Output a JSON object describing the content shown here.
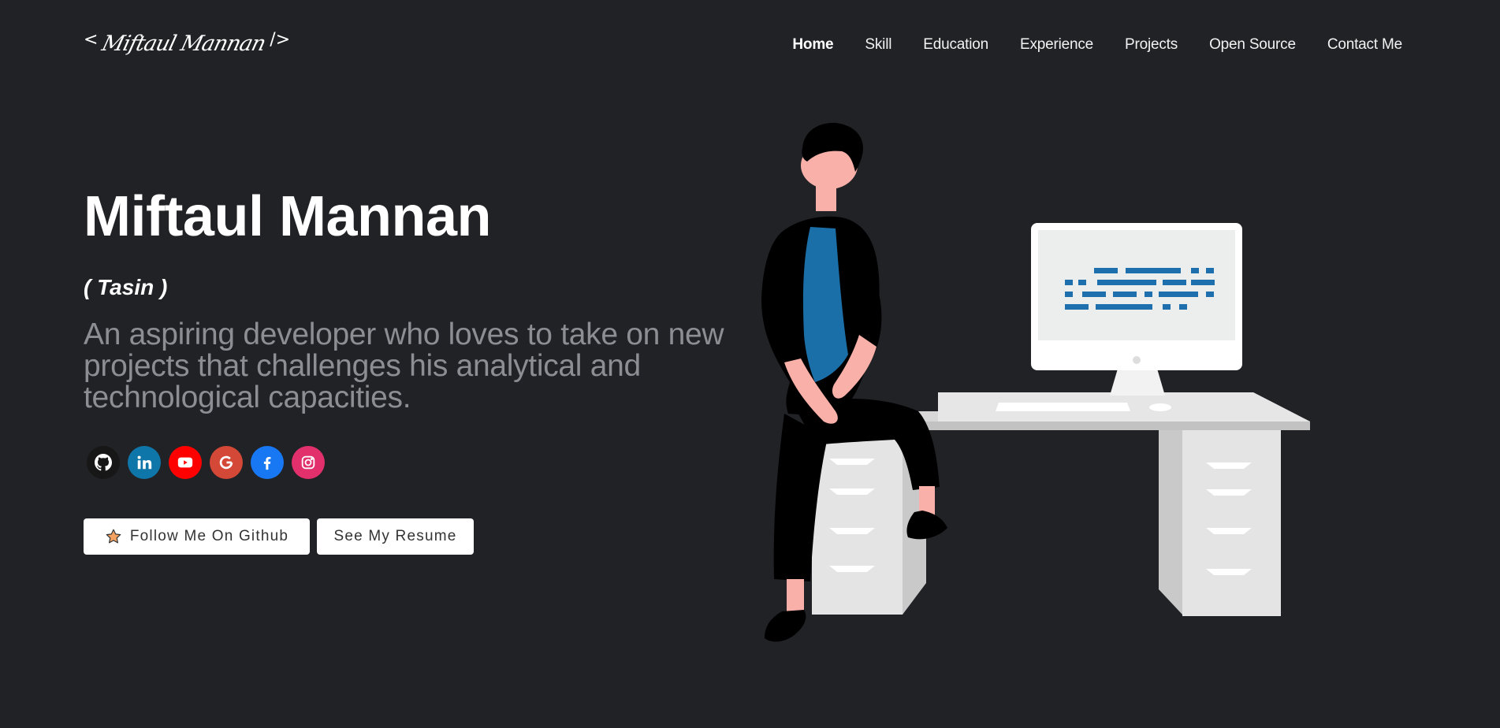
{
  "header": {
    "logo": {
      "open_bracket": "<",
      "signature": "Miftaul Mannan",
      "close_bracket": "/>"
    },
    "nav": [
      {
        "label": "Home",
        "active": true
      },
      {
        "label": "Skill"
      },
      {
        "label": "Education"
      },
      {
        "label": "Experience"
      },
      {
        "label": "Projects"
      },
      {
        "label": "Open Source"
      },
      {
        "label": "Contact Me"
      }
    ]
  },
  "hero": {
    "name": "Miftaul Mannan",
    "nickname": "( Tasin )",
    "tagline": "An aspiring developer who loves to take on new projects that challenges his analytical and technological capacities."
  },
  "social": [
    {
      "icon": "github-icon",
      "color": "#181717"
    },
    {
      "icon": "linkedin-icon",
      "color": "#0e76a8"
    },
    {
      "icon": "youtube-icon",
      "color": "#ff0000"
    },
    {
      "icon": "google-icon",
      "color": "#d34836"
    },
    {
      "icon": "facebook-icon",
      "color": "#1877f2"
    },
    {
      "icon": "instagram-icon",
      "color": "#e1306c"
    }
  ],
  "buttons": {
    "github_label": "Follow Me On Github",
    "resume_label": "See My Resume"
  },
  "colors": {
    "background": "#212226",
    "tagline": "#8c8e93",
    "screen_code": "#1d6fad",
    "shirt": "#1b6fa8",
    "skin": "#f9b0a8"
  }
}
